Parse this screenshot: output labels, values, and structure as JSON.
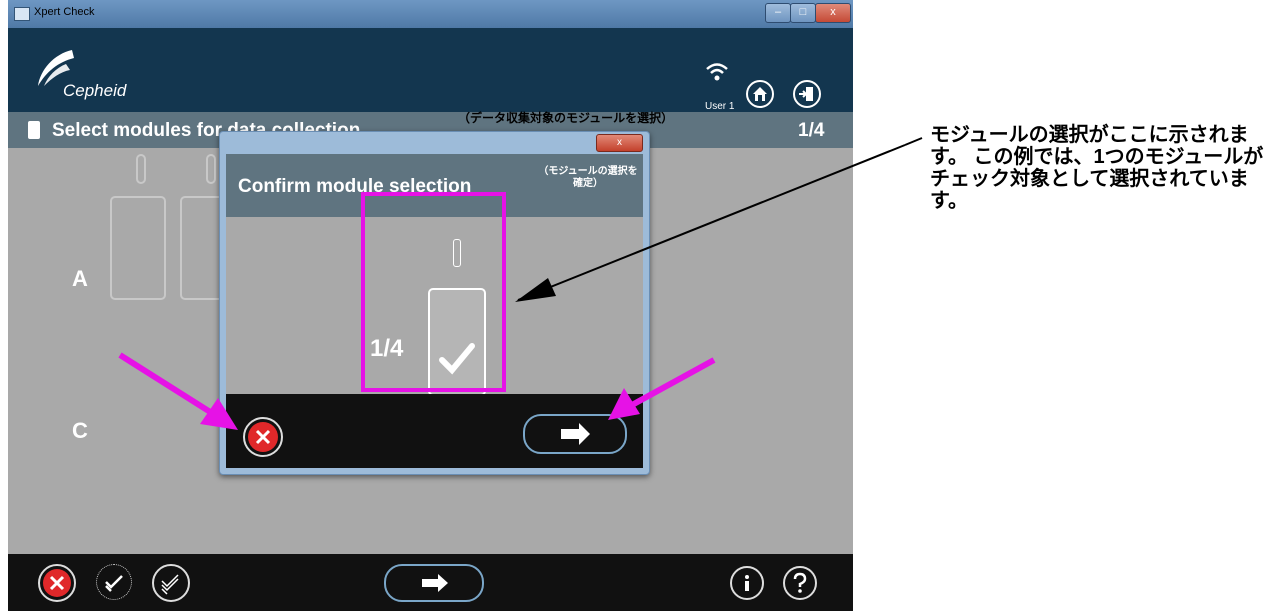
{
  "window": {
    "title": "Xpert Check",
    "controls": {
      "minimize": "–",
      "maximize": "□",
      "close": "x"
    }
  },
  "header": {
    "logo_text": "Cepheid",
    "user_label": "User 1",
    "icons": [
      "wifi-icon",
      "home-icon",
      "exit-icon"
    ]
  },
  "page": {
    "title": "Select modules for data collection",
    "count": "1/4",
    "row_labels": [
      "A",
      "C"
    ]
  },
  "dialog": {
    "title": "Confirm module selection",
    "title_jp": "（モジュールの選択を確定）",
    "module_count": "1/4",
    "close_label": "x"
  },
  "annotations": {
    "top_jp": "（データ収集対象のモジュールを選択）",
    "side_jp": "モジュールの選択がここに示されます。 この例では、1つのモジュールがチェック対象として選択されています。"
  },
  "colors": {
    "header_bg": "#13364f",
    "subheader_bg": "#5f7480",
    "content_bg": "#a9a9a9",
    "highlight": "#e612e6",
    "cancel_red": "#e0282a"
  }
}
